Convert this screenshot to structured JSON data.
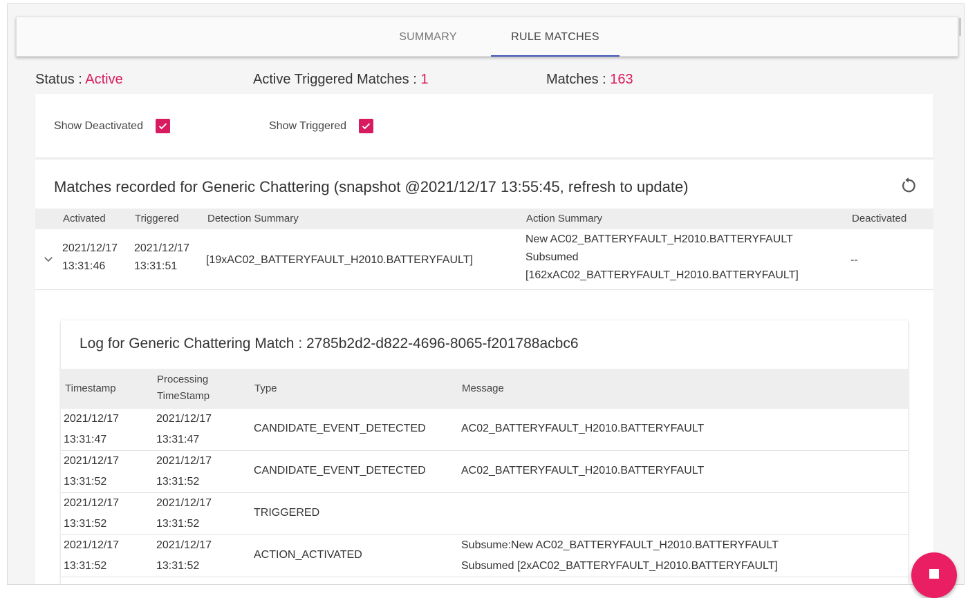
{
  "tabs": [
    {
      "label": "SUMMARY",
      "active": false
    },
    {
      "label": "RULE MATCHES",
      "active": true
    }
  ],
  "status": {
    "status_label": "Status :",
    "status_value": "Active",
    "active_triggered_label": "Active Triggered Matches :",
    "active_triggered_value": "1",
    "matches_label": "Matches :",
    "matches_value": "163"
  },
  "filters": {
    "show_deactivated": {
      "label": "Show Deactivated",
      "checked": true
    },
    "show_triggered": {
      "label": "Show Triggered",
      "checked": true
    }
  },
  "matches": {
    "title": "Matches recorded for Generic Chattering (snapshot @2021/12/17 13:55:45, refresh to update)",
    "columns": [
      "Activated",
      "Triggered",
      "Detection Summary",
      "Action Summary",
      "Deactivated"
    ],
    "row": {
      "activated_date": "2021/12/17",
      "activated_time": "13:31:46",
      "triggered_date": "2021/12/17",
      "triggered_time": "13:31:51",
      "detection": "[19xAC02_BATTERYFAULT_H2010.BATTERYFAULT]",
      "action_line1": "New AC02_BATTERYFAULT_H2010.BATTERYFAULT",
      "action_line2": "Subsumed",
      "action_line3": "[162xAC02_BATTERYFAULT_H2010.BATTERYFAULT]",
      "deactivated": "--"
    }
  },
  "log": {
    "title": "Log for Generic Chattering Match : 2785b2d2-d822-4696-8065-f201788acbc6",
    "columns": {
      "timestamp": "Timestamp",
      "processing_line1": "Processing",
      "processing_line2": "TimeStamp",
      "type": "Type",
      "message": "Message"
    },
    "rows": [
      {
        "ts_date": "2021/12/17",
        "ts_time": "13:31:47",
        "pts_date": "2021/12/17",
        "pts_time": "13:31:47",
        "type": "CANDIDATE_EVENT_DETECTED",
        "msg1": "AC02_BATTERYFAULT_H2010.BATTERYFAULT",
        "msg2": ""
      },
      {
        "ts_date": "2021/12/17",
        "ts_time": "13:31:52",
        "pts_date": "2021/12/17",
        "pts_time": "13:31:52",
        "type": "CANDIDATE_EVENT_DETECTED",
        "msg1": "AC02_BATTERYFAULT_H2010.BATTERYFAULT",
        "msg2": ""
      },
      {
        "ts_date": "2021/12/17",
        "ts_time": "13:31:52",
        "pts_date": "2021/12/17",
        "pts_time": "13:31:52",
        "type": "TRIGGERED",
        "msg1": "",
        "msg2": ""
      },
      {
        "ts_date": "2021/12/17",
        "ts_time": "13:31:52",
        "pts_date": "2021/12/17",
        "pts_time": "13:31:52",
        "type": "ACTION_ACTIVATED",
        "msg1": "Subsume:New AC02_BATTERYFAULT_H2010.BATTERYFAULT",
        "msg2": "Subsumed [2xAC02_BATTERYFAULT_H2010.BATTERYFAULT]"
      }
    ]
  },
  "colors": {
    "accent": "#d81b60",
    "tab_indicator": "#3f51b5",
    "fab": "#e91e63"
  },
  "icons": {
    "refresh": "refresh-icon",
    "expand": "chevron-down-icon",
    "checkbox": "check-icon",
    "fab": "stop-icon"
  }
}
